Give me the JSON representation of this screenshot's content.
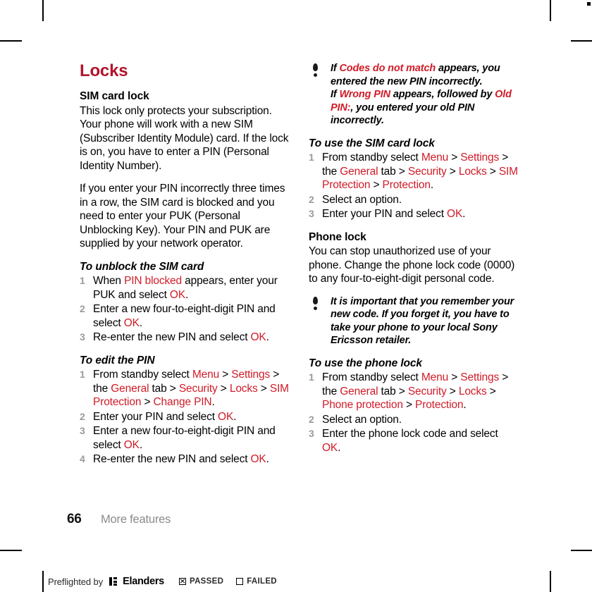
{
  "page": {
    "folio": "66",
    "running_head": "More features",
    "accent_heading_color": "#b3132b",
    "accent_inline_color": "#d01c28",
    "step_number_color": "#9a9a9a"
  },
  "left_column": {
    "title": "Locks",
    "sim_card_lock": {
      "heading": "SIM card lock",
      "para1": "This lock only protects your subscription. Your phone will work with a new SIM (Subscriber Identity Module) card. If the lock is on, you have to enter a PIN (Personal Identity Number).",
      "para2": "If you enter your PIN incorrectly three times in a row, the SIM card is blocked and you need to enter your PUK (Personal Unblocking Key). Your PIN and PUK are supplied by your network operator."
    },
    "unblock_sim": {
      "heading": "To unblock the SIM card",
      "steps": [
        {
          "num": "1",
          "parts": [
            {
              "t": "When ",
              "c": "black"
            },
            {
              "t": "PIN blocked",
              "c": "red"
            },
            {
              "t": " appears, enter your PUK and select ",
              "c": "black"
            },
            {
              "t": "OK",
              "c": "red"
            },
            {
              "t": ".",
              "c": "black"
            }
          ]
        },
        {
          "num": "2",
          "parts": [
            {
              "t": "Enter a new four-to-eight-digit PIN and select ",
              "c": "black"
            },
            {
              "t": "OK",
              "c": "red"
            },
            {
              "t": ".",
              "c": "black"
            }
          ]
        },
        {
          "num": "3",
          "parts": [
            {
              "t": "Re-enter the new PIN and select ",
              "c": "black"
            },
            {
              "t": "OK",
              "c": "red"
            },
            {
              "t": ".",
              "c": "black"
            }
          ]
        }
      ]
    },
    "edit_pin": {
      "heading": "To edit the PIN",
      "steps": [
        {
          "num": "1",
          "parts": [
            {
              "t": "From standby select ",
              "c": "black"
            },
            {
              "t": "Menu",
              "c": "red"
            },
            {
              "t": " > ",
              "c": "black"
            },
            {
              "t": "Settings",
              "c": "red"
            },
            {
              "t": " > the ",
              "c": "black"
            },
            {
              "t": "General",
              "c": "red"
            },
            {
              "t": " tab > ",
              "c": "black"
            },
            {
              "t": "Security",
              "c": "red"
            },
            {
              "t": " > ",
              "c": "black"
            },
            {
              "t": "Locks",
              "c": "red"
            },
            {
              "t": " > ",
              "c": "black"
            },
            {
              "t": "SIM Protection",
              "c": "red"
            },
            {
              "t": " > ",
              "c": "black"
            },
            {
              "t": "Change PIN",
              "c": "red"
            },
            {
              "t": ".",
              "c": "black"
            }
          ]
        },
        {
          "num": "2",
          "parts": [
            {
              "t": "Enter your PIN and select ",
              "c": "black"
            },
            {
              "t": "OK",
              "c": "red"
            },
            {
              "t": ".",
              "c": "black"
            }
          ]
        },
        {
          "num": "3",
          "parts": [
            {
              "t": "Enter a new four-to-eight-digit PIN and select ",
              "c": "black"
            },
            {
              "t": "OK",
              "c": "red"
            },
            {
              "t": ".",
              "c": "black"
            }
          ]
        },
        {
          "num": "4",
          "parts": [
            {
              "t": "Re-enter the new PIN and select ",
              "c": "black"
            },
            {
              "t": "OK",
              "c": "red"
            },
            {
              "t": ".",
              "c": "black"
            }
          ]
        }
      ]
    }
  },
  "right_column": {
    "note1": {
      "icon": "exclamation-icon",
      "parts": [
        {
          "t": "If ",
          "c": "black"
        },
        {
          "t": "Codes do not match",
          "c": "red"
        },
        {
          "t": " appears, you entered the new PIN incorrectly.",
          "c": "black"
        },
        {
          "t": "\n",
          "c": "break"
        },
        {
          "t": "If ",
          "c": "black"
        },
        {
          "t": "Wrong PIN",
          "c": "red"
        },
        {
          "t": " appears, followed by ",
          "c": "black"
        },
        {
          "t": "Old PIN:",
          "c": "red"
        },
        {
          "t": ", you entered your old PIN incorrectly.",
          "c": "black"
        }
      ]
    },
    "use_sim_lock": {
      "heading": "To use the SIM card lock",
      "steps": [
        {
          "num": "1",
          "parts": [
            {
              "t": "From standby select ",
              "c": "black"
            },
            {
              "t": "Menu",
              "c": "red"
            },
            {
              "t": " > ",
              "c": "black"
            },
            {
              "t": "Settings",
              "c": "red"
            },
            {
              "t": " > the ",
              "c": "black"
            },
            {
              "t": "General",
              "c": "red"
            },
            {
              "t": " tab > ",
              "c": "black"
            },
            {
              "t": "Security",
              "c": "red"
            },
            {
              "t": " > ",
              "c": "black"
            },
            {
              "t": "Locks",
              "c": "red"
            },
            {
              "t": " > ",
              "c": "black"
            },
            {
              "t": "SIM Protection",
              "c": "red"
            },
            {
              "t": " > ",
              "c": "black"
            },
            {
              "t": "Protection",
              "c": "red"
            },
            {
              "t": ".",
              "c": "black"
            }
          ]
        },
        {
          "num": "2",
          "parts": [
            {
              "t": "Select an option.",
              "c": "black"
            }
          ]
        },
        {
          "num": "3",
          "parts": [
            {
              "t": "Enter your PIN and select ",
              "c": "black"
            },
            {
              "t": "OK",
              "c": "red"
            },
            {
              "t": ".",
              "c": "black"
            }
          ]
        }
      ]
    },
    "phone_lock": {
      "heading": "Phone lock",
      "para1": "You can stop unauthorized use of your phone. Change the phone lock code (0000) to any four-to-eight-digit personal code."
    },
    "note2": {
      "icon": "exclamation-icon",
      "parts": [
        {
          "t": "It is important that you remember your new code. If you forget it, you have to take your phone to your local Sony Ericsson retailer.",
          "c": "black"
        }
      ]
    },
    "use_phone_lock": {
      "heading": "To use the phone lock",
      "steps": [
        {
          "num": "1",
          "parts": [
            {
              "t": "From standby select ",
              "c": "black"
            },
            {
              "t": "Menu",
              "c": "red"
            },
            {
              "t": " > ",
              "c": "black"
            },
            {
              "t": "Settings",
              "c": "red"
            },
            {
              "t": " > the ",
              "c": "black"
            },
            {
              "t": "General",
              "c": "red"
            },
            {
              "t": " tab > ",
              "c": "black"
            },
            {
              "t": "Security",
              "c": "red"
            },
            {
              "t": " > ",
              "c": "black"
            },
            {
              "t": "Locks",
              "c": "red"
            },
            {
              "t": " > ",
              "c": "black"
            },
            {
              "t": "Phone protection",
              "c": "red"
            },
            {
              "t": " > ",
              "c": "black"
            },
            {
              "t": "Protection",
              "c": "red"
            },
            {
              "t": ".",
              "c": "black"
            }
          ]
        },
        {
          "num": "2",
          "parts": [
            {
              "t": "Select an option.",
              "c": "black"
            }
          ]
        },
        {
          "num": "3",
          "parts": [
            {
              "t": "Enter the phone lock code and select ",
              "c": "black"
            },
            {
              "t": "OK",
              "c": "red"
            },
            {
              "t": ".",
              "c": "black"
            }
          ]
        }
      ]
    }
  },
  "preflight": {
    "text": "Preflighted by",
    "brand": "Elanders",
    "passed_label": "PASSED",
    "failed_label": "FAILED",
    "passed_checked": true,
    "failed_checked": false
  }
}
